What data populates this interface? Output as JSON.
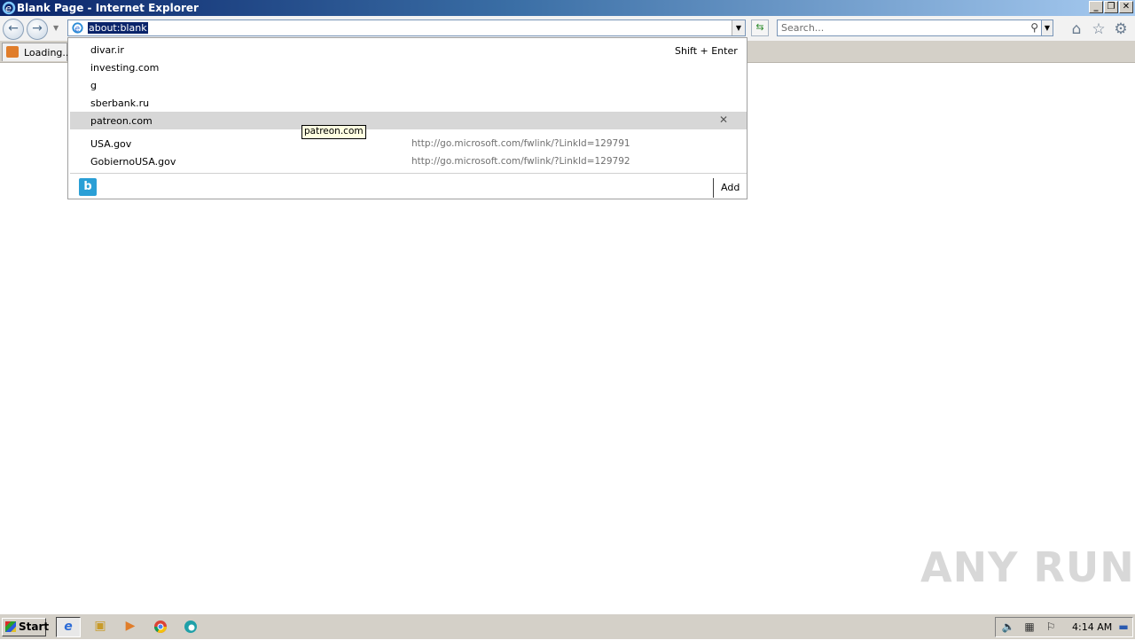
{
  "window": {
    "title": "Blank Page - Internet Explorer",
    "buttons": [
      "minimize",
      "restore",
      "close"
    ]
  },
  "navbar": {
    "address_value": "about:blank",
    "search_placeholder": "Search...",
    "icons": [
      "back-icon",
      "forward-icon",
      "ie-page-icon",
      "refresh-icon",
      "search-icon",
      "home-icon",
      "favorites-icon",
      "tools-gear-icon"
    ]
  },
  "tab": {
    "label": "Loading..."
  },
  "dropdown": {
    "shift_enter": "Shift + Enter",
    "history": [
      {
        "label": "divar.ir"
      },
      {
        "label": "investing.com"
      },
      {
        "label": "g"
      },
      {
        "label": "sberbank.ru"
      },
      {
        "label": "patreon.com",
        "highlighted": true
      }
    ],
    "favorites": [
      {
        "label": "USA.gov",
        "url": "http://go.microsoft.com/fwlink/?LinkId=129791"
      },
      {
        "label": "GobiernoUSA.gov",
        "url": "http://go.microsoft.com/fwlink/?LinkId=129792"
      }
    ],
    "add_label": "Add",
    "tooltip": "patreon.com"
  },
  "watermark": "ANY RUN",
  "taskbar": {
    "start_label": "Start",
    "apps": [
      "internet-explorer-icon",
      "file-explorer-icon",
      "media-player-icon",
      "chrome-icon",
      "edge-icon"
    ],
    "clock": "4:14 AM"
  },
  "colors": {
    "titlebar_start": "#0a246a",
    "titlebar_end": "#a6caf0",
    "selection": "#0a246a",
    "highlight_row": "#d7d7d7",
    "taskbar": "#d4d0c8"
  }
}
